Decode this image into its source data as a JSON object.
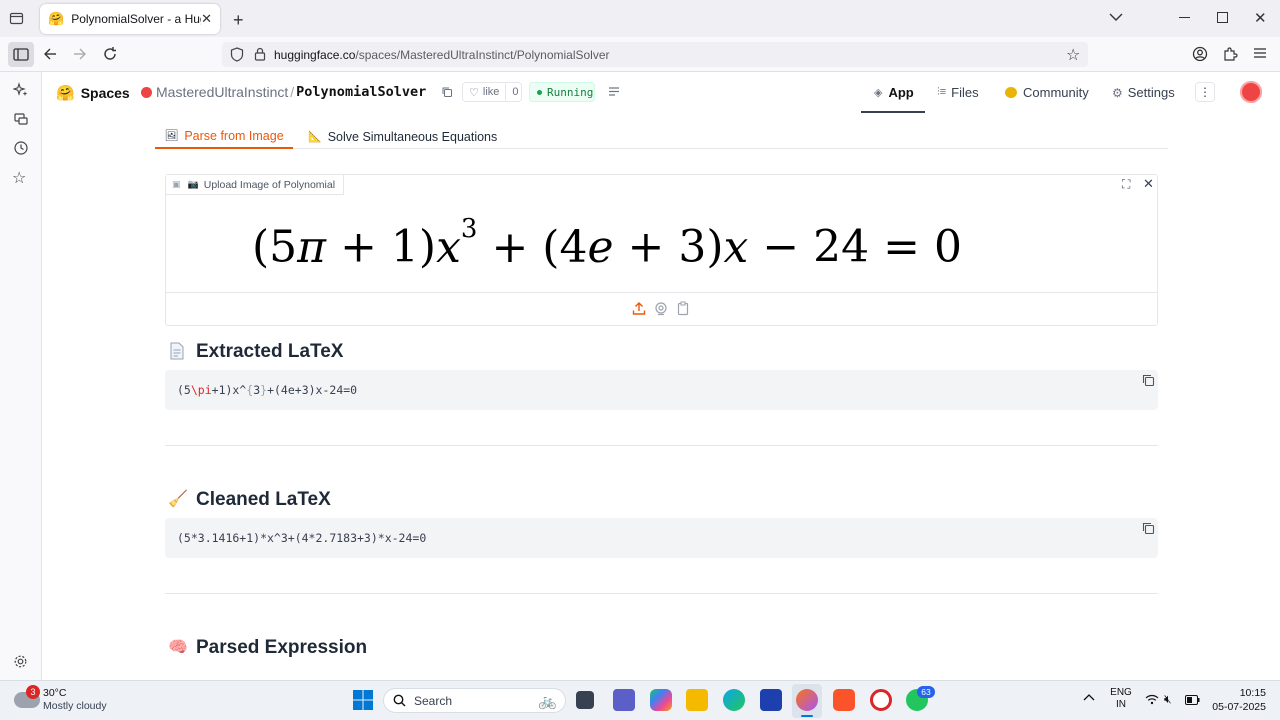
{
  "browser": {
    "tab_title": "PolynomialSolver - a Hugging F",
    "url_host": "huggingface.co",
    "url_path": "/spaces/MasteredUltraInstinct/PolynomialSolver"
  },
  "hf_header": {
    "spaces_label": "Spaces",
    "owner": "MasteredUltraInstinct",
    "separator": "/",
    "space_name": "PolynomialSolver",
    "like_label": "like",
    "like_count": "0",
    "status": "Running",
    "nav": {
      "app": "App",
      "files": "Files",
      "community": "Community",
      "settings": "Settings"
    }
  },
  "app": {
    "tabs": [
      {
        "label": "Parse from Image",
        "icon": "picture-icon",
        "active": true
      },
      {
        "label": "Solve Simultaneous Equations",
        "icon": "triangle-ruler-icon",
        "active": false
      }
    ],
    "upload_label": "Upload Image of Polynomial",
    "sections": {
      "extracted": {
        "title": "Extracted LaTeX",
        "latex_parts": [
          "(5",
          "\\pi",
          "+1)x^",
          "{",
          "3",
          "}",
          "+(4e+3)x-24=0"
        ]
      },
      "cleaned": {
        "title": "Cleaned LaTeX",
        "text": "(5*3.1416+1)*x^3+(4*2.7183+3)*x-24=0"
      },
      "parsed": {
        "title": "Parsed Expression"
      }
    }
  },
  "taskbar": {
    "weather_temp": "30°C",
    "weather_desc": "Mostly cloudy",
    "weather_badge": "3",
    "search_label": "Search",
    "whatsapp_badge": "63",
    "lang_top": "ENG",
    "lang_bottom": "IN",
    "time": "10:15",
    "date": "05-07-2025"
  },
  "colors": {
    "accent_orange": "#ea580c",
    "running_green": "#16a34a",
    "code_bg": "#f3f4f6"
  }
}
